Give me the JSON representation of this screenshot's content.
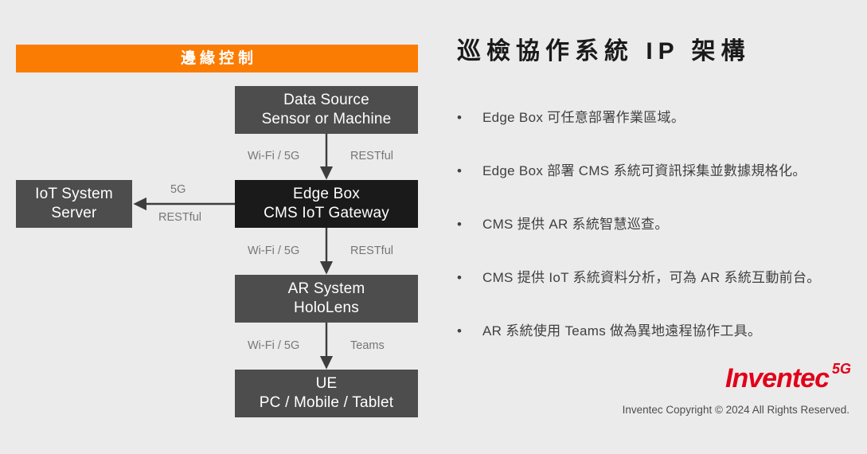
{
  "slide": {
    "background_color": "#ebebeb"
  },
  "diagram": {
    "section_header": {
      "label": "邊緣控制",
      "background_color": "#fb7c03",
      "text_color": "#ffffff"
    },
    "nodes": [
      {
        "id": "data-source",
        "line1": "Data Source",
        "line2": "Sensor or Machine",
        "fill": "#4d4d4d"
      },
      {
        "id": "edge-box",
        "line1": "Edge Box",
        "line2": "CMS IoT Gateway",
        "fill": "#1a1a1a"
      },
      {
        "id": "iot-server",
        "line1": "IoT System",
        "line2": "Server",
        "fill": "#4d4d4d"
      },
      {
        "id": "ar-system",
        "line1": "AR System",
        "line2": "HoloLens",
        "fill": "#4d4d4d"
      },
      {
        "id": "ue",
        "line1": "UE",
        "line2": "PC / Mobile / Tablet",
        "fill": "#4d4d4d"
      }
    ],
    "edge_labels": {
      "data_source_to_edge_box_left": "Wi-Fi / 5G",
      "data_source_to_edge_box_right": "RESTful",
      "edge_box_to_ar_left": "Wi-Fi / 5G",
      "edge_box_to_ar_right": "RESTful",
      "ar_to_ue_left": "Wi-Fi / 5G",
      "ar_to_ue_right": "Teams",
      "edge_box_to_iot_top": "5G",
      "edge_box_to_iot_bottom": "RESTful"
    }
  },
  "panel": {
    "title": "巡檢協作系統 IP 架構",
    "bullet_marker": "•",
    "bullets": [
      {
        "text": "Edge Box 可任意部署作業區域。"
      },
      {
        "text": "Edge Box 部署 CMS 系統可資訊採集並數據規格化。"
      },
      {
        "text": "CMS 提供 AR 系統智慧巡查。"
      },
      {
        "text": "CMS 提供 IoT 系統資料分析，可為 AR 系統互動前台。"
      },
      {
        "text": "AR 系統使用 Teams 做為異地遠程協作工具。"
      }
    ]
  },
  "brand": {
    "name": "Inventec",
    "superscript": "5G",
    "color": "#e2001a",
    "copyright": "Inventec Copyright © 2024  All Rights Reserved."
  }
}
